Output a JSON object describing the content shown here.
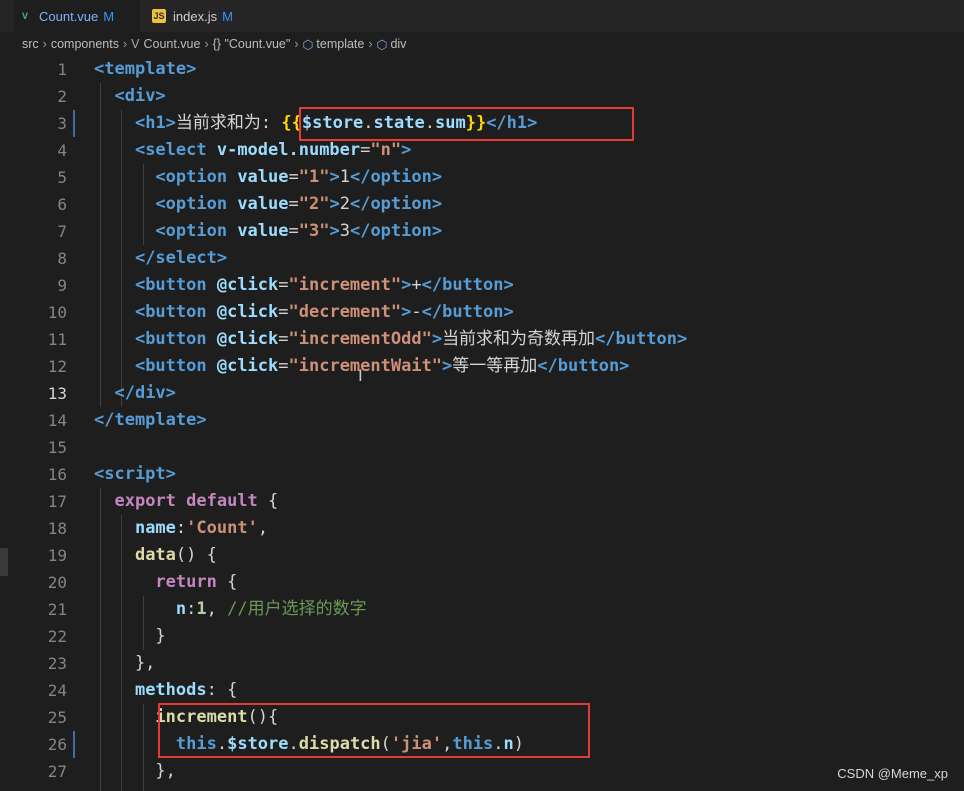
{
  "tabs": [
    {
      "icon": "vue-icon",
      "label": "Count.vue",
      "status": "M"
    },
    {
      "icon": "js-icon",
      "label": "index.js",
      "status": "M"
    }
  ],
  "breadcrumb": [
    "src",
    "components",
    "Count.vue",
    "{} \"Count.vue\"",
    "template",
    "div"
  ],
  "lines": [
    {
      "num": "1",
      "tokens": [
        [
          "t",
          "<template>"
        ]
      ]
    },
    {
      "num": "2",
      "tokens": [
        [
          "txt",
          "  "
        ],
        [
          "t",
          "<div>"
        ]
      ]
    },
    {
      "num": "3",
      "tokens": [
        [
          "txt",
          "    "
        ],
        [
          "t",
          "<h1>"
        ],
        [
          "txt",
          "当前求和为: "
        ],
        [
          "br",
          "{{"
        ],
        [
          "v",
          "$store"
        ],
        [
          "txt",
          "."
        ],
        [
          "v",
          "state"
        ],
        [
          "txt",
          "."
        ],
        [
          "v",
          "sum"
        ],
        [
          "br",
          "}}"
        ],
        [
          "t",
          "</h1>"
        ]
      ]
    },
    {
      "num": "4",
      "tokens": [
        [
          "txt",
          "    "
        ],
        [
          "t",
          "<select "
        ],
        [
          "a",
          "v-model.number"
        ],
        [
          "txt",
          "="
        ],
        [
          "s",
          "\"n\""
        ],
        [
          "t",
          ">"
        ]
      ]
    },
    {
      "num": "5",
      "tokens": [
        [
          "txt",
          "      "
        ],
        [
          "t",
          "<option "
        ],
        [
          "a",
          "value"
        ],
        [
          "txt",
          "="
        ],
        [
          "s",
          "\"1\""
        ],
        [
          "t",
          ">"
        ],
        [
          "txt",
          "1"
        ],
        [
          "t",
          "</option>"
        ]
      ]
    },
    {
      "num": "6",
      "tokens": [
        [
          "txt",
          "      "
        ],
        [
          "t",
          "<option "
        ],
        [
          "a",
          "value"
        ],
        [
          "txt",
          "="
        ],
        [
          "s",
          "\"2\""
        ],
        [
          "t",
          ">"
        ],
        [
          "txt",
          "2"
        ],
        [
          "t",
          "</option>"
        ]
      ]
    },
    {
      "num": "7",
      "tokens": [
        [
          "txt",
          "      "
        ],
        [
          "t",
          "<option "
        ],
        [
          "a",
          "value"
        ],
        [
          "txt",
          "="
        ],
        [
          "s",
          "\"3\""
        ],
        [
          "t",
          ">"
        ],
        [
          "txt",
          "3"
        ],
        [
          "t",
          "</option>"
        ]
      ]
    },
    {
      "num": "8",
      "tokens": [
        [
          "txt",
          "    "
        ],
        [
          "t",
          "</select>"
        ]
      ]
    },
    {
      "num": "9",
      "tokens": [
        [
          "txt",
          "    "
        ],
        [
          "t",
          "<button "
        ],
        [
          "a",
          "@click"
        ],
        [
          "txt",
          "="
        ],
        [
          "s",
          "\"increment\""
        ],
        [
          "t",
          ">"
        ],
        [
          "txt",
          "+"
        ],
        [
          "t",
          "</button>"
        ]
      ]
    },
    {
      "num": "10",
      "tokens": [
        [
          "txt",
          "    "
        ],
        [
          "t",
          "<button "
        ],
        [
          "a",
          "@click"
        ],
        [
          "txt",
          "="
        ],
        [
          "s",
          "\"decrement\""
        ],
        [
          "t",
          ">"
        ],
        [
          "txt",
          "-"
        ],
        [
          "t",
          "</button>"
        ]
      ]
    },
    {
      "num": "11",
      "tokens": [
        [
          "txt",
          "    "
        ],
        [
          "t",
          "<button "
        ],
        [
          "a",
          "@click"
        ],
        [
          "txt",
          "="
        ],
        [
          "s",
          "\"incrementOdd\""
        ],
        [
          "t",
          ">"
        ],
        [
          "txt",
          "当前求和为奇数再加"
        ],
        [
          "t",
          "</button>"
        ]
      ]
    },
    {
      "num": "12",
      "tokens": [
        [
          "txt",
          "    "
        ],
        [
          "t",
          "<button "
        ],
        [
          "a",
          "@click"
        ],
        [
          "txt",
          "="
        ],
        [
          "s",
          "\"incrementWait\""
        ],
        [
          "t",
          ">"
        ],
        [
          "txt",
          "等一等再加"
        ],
        [
          "t",
          "</button>"
        ]
      ]
    },
    {
      "num": "13",
      "tokens": [
        [
          "txt",
          "  "
        ],
        [
          "t",
          "</div>"
        ]
      ]
    },
    {
      "num": "14",
      "tokens": [
        [
          "t",
          "</template>"
        ]
      ]
    },
    {
      "num": "15",
      "tokens": []
    },
    {
      "num": "16",
      "tokens": [
        [
          "t",
          "<script>"
        ]
      ]
    },
    {
      "num": "17",
      "tokens": [
        [
          "txt",
          "  "
        ],
        [
          "k",
          "export default "
        ],
        [
          "txt",
          "{"
        ]
      ]
    },
    {
      "num": "18",
      "tokens": [
        [
          "txt",
          "    "
        ],
        [
          "v",
          "name"
        ],
        [
          "txt",
          ":"
        ],
        [
          "s",
          "'Count'"
        ],
        [
          "txt",
          ","
        ]
      ]
    },
    {
      "num": "19",
      "tokens": [
        [
          "txt",
          "    "
        ],
        [
          "f",
          "data"
        ],
        [
          "txt",
          "() {"
        ]
      ]
    },
    {
      "num": "20",
      "tokens": [
        [
          "txt",
          "      "
        ],
        [
          "k",
          "return "
        ],
        [
          "txt",
          "{"
        ]
      ]
    },
    {
      "num": "21",
      "tokens": [
        [
          "txt",
          "        "
        ],
        [
          "v",
          "n"
        ],
        [
          "txt",
          ":"
        ],
        [
          "n",
          "1"
        ],
        [
          "txt",
          ", "
        ],
        [
          "c",
          "//用户选择的数字"
        ]
      ]
    },
    {
      "num": "22",
      "tokens": [
        [
          "txt",
          "      }"
        ]
      ]
    },
    {
      "num": "23",
      "tokens": [
        [
          "txt",
          "    },"
        ]
      ]
    },
    {
      "num": "24",
      "tokens": [
        [
          "txt",
          "    "
        ],
        [
          "v",
          "methods"
        ],
        [
          "txt",
          ": {"
        ]
      ]
    },
    {
      "num": "25",
      "tokens": [
        [
          "txt",
          "      "
        ],
        [
          "f",
          "increment"
        ],
        [
          "txt",
          "(){"
        ]
      ]
    },
    {
      "num": "26",
      "tokens": [
        [
          "txt",
          "        "
        ],
        [
          "kw",
          "this"
        ],
        [
          "txt",
          "."
        ],
        [
          "v",
          "$store"
        ],
        [
          "txt",
          "."
        ],
        [
          "f",
          "dispatch"
        ],
        [
          "txt",
          "("
        ],
        [
          "s",
          "'jia'"
        ],
        [
          "txt",
          ","
        ],
        [
          "kw",
          "this"
        ],
        [
          "txt",
          "."
        ],
        [
          "v",
          "n"
        ],
        [
          "txt",
          ")"
        ]
      ]
    },
    {
      "num": "27",
      "tokens": [
        [
          "txt",
          "      },"
        ]
      ]
    }
  ],
  "active_line": "13",
  "watermark": "CSDN @Meme_xp",
  "colors": {
    "highlight_box": "#e53935",
    "editor_bg": "#1e1e1e"
  }
}
